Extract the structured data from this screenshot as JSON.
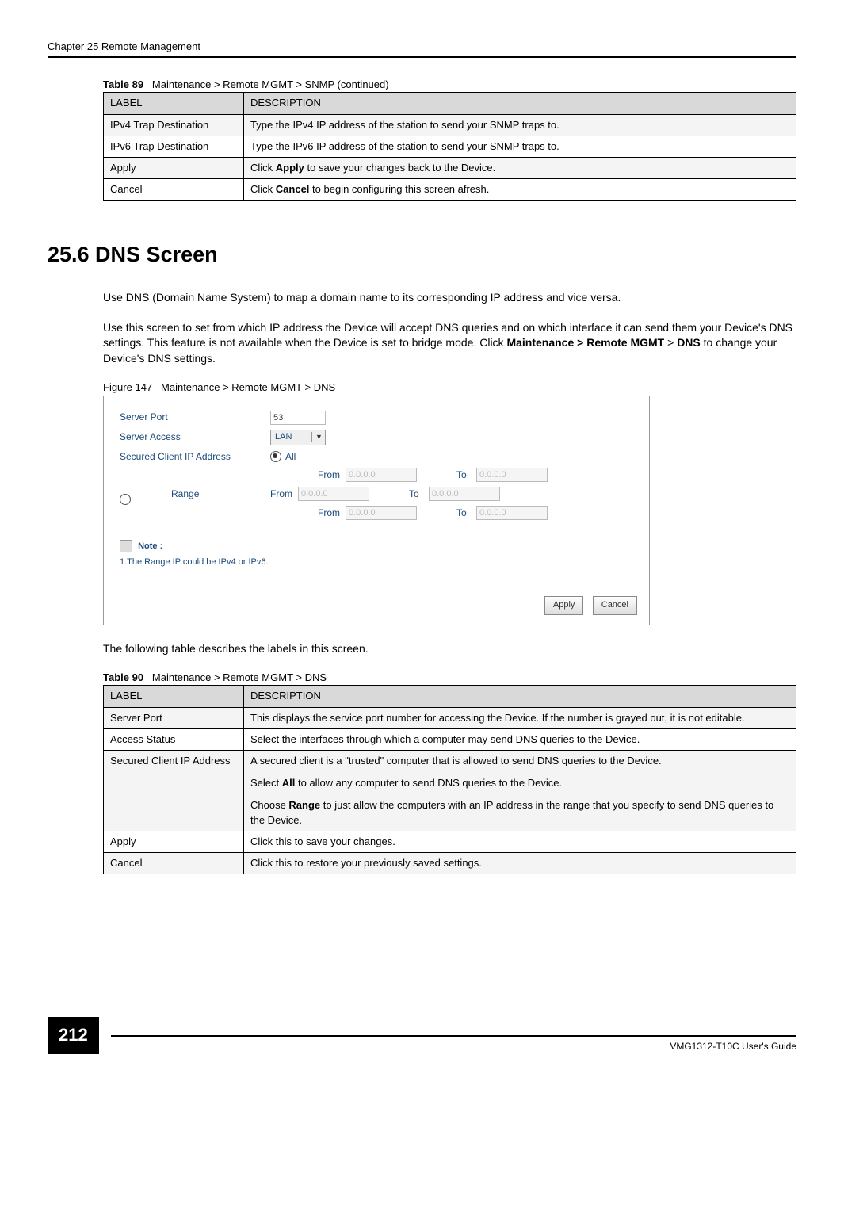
{
  "chapter_header": "Chapter 25 Remote Management",
  "table89": {
    "caption_prefix": "Table 89",
    "caption": "Maintenance > Remote MGMT > SNMP (continued)",
    "headers": {
      "label": "LABEL",
      "description": "DESCRIPTION"
    },
    "rows": [
      {
        "label": "IPv4 Trap Destination",
        "desc": "Type the IPv4 IP address of the station to send your SNMP traps to."
      },
      {
        "label": "IPv6 Trap Destination",
        "desc": "Type the IPv6 IP address of the station to send your SNMP traps to."
      },
      {
        "label": "Apply",
        "desc_pre": "Click ",
        "desc_bold": "Apply",
        "desc_post": " to save your changes back to the Device."
      },
      {
        "label": "Cancel",
        "desc_pre": "Click ",
        "desc_bold": "Cancel",
        "desc_post": " to begin configuring this screen afresh."
      }
    ]
  },
  "section_heading": "25.6  DNS Screen",
  "para1": "Use DNS (Domain Name System) to map a domain name to its corresponding IP address and vice versa.",
  "para2_pre": "Use this screen to set from which IP address the Device will accept DNS queries and on which interface it can send them your Device's DNS settings. This feature is not available when the Device is set to bridge mode. Click ",
  "para2_bold1": "Maintenance > Remote MGMT",
  "para2_mid": " > ",
  "para2_bold2": "DNS",
  "para2_post": " to change your Device's DNS settings.",
  "figure": {
    "prefix": "Figure 147",
    "caption": "Maintenance > Remote MGMT > DNS",
    "server_port_label": "Server Port",
    "server_port_value": "53",
    "server_access_label": "Server Access",
    "server_access_value": "LAN",
    "secured_client_label": "Secured Client IP Address",
    "all_label": "All",
    "range_label": "Range",
    "from_label": "From",
    "to_label": "To",
    "ip_placeholder": "0.0.0.0",
    "note_label": "Note :",
    "note_text": "1.The Range IP could be IPv4 or IPv6.",
    "apply_btn": "Apply",
    "cancel_btn": "Cancel"
  },
  "after_figure_text": "The following table describes the labels in this screen.",
  "table90": {
    "caption_prefix": "Table 90",
    "caption": "Maintenance > Remote MGMT > DNS",
    "headers": {
      "label": "LABEL",
      "description": "DESCRIPTION"
    },
    "rows": [
      {
        "label": "Server Port",
        "desc": "This displays the service port number for accessing the Device. If the number is grayed out, it is not editable."
      },
      {
        "label": "Access Status",
        "desc": "Select the interfaces through which a computer may send DNS queries to the Device."
      },
      {
        "label": "Secured Client IP Address",
        "desc_p1": "A secured client is a \"trusted\" computer that is allowed to send DNS queries to the Device.",
        "desc_p2_pre": "Select ",
        "desc_p2_bold": "All",
        "desc_p2_post": " to allow any computer to send DNS queries to the Device.",
        "desc_p3_pre": "Choose ",
        "desc_p3_bold": "Range",
        "desc_p3_post": " to just allow the computers with an IP address in the range that you specify to send DNS queries to the Device."
      },
      {
        "label": "Apply",
        "desc": "Click this to save your changes."
      },
      {
        "label": "Cancel",
        "desc": "Click this to restore your previously saved settings."
      }
    ]
  },
  "footer": {
    "page_number": "212",
    "guide": "VMG1312-T10C User's Guide"
  }
}
